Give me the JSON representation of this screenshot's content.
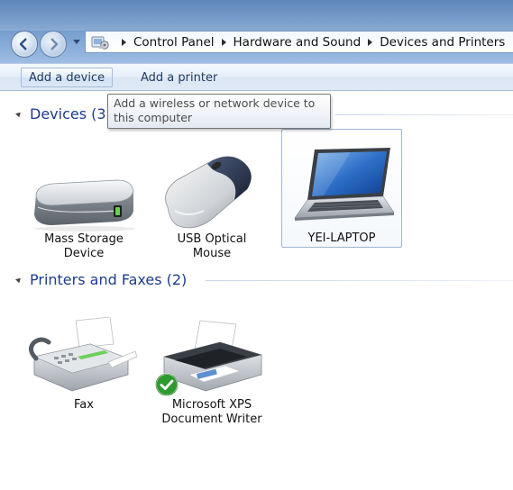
{
  "window": {
    "breadcrumbs": [
      "Control Panel",
      "Hardware and Sound",
      "Devices and Printers"
    ]
  },
  "toolbar": {
    "add_device_label": "Add a device",
    "add_printer_label": "Add a printer"
  },
  "tooltip": {
    "line1": "Add a wireless or network device to",
    "line2": "this computer"
  },
  "groups": {
    "devices": {
      "header": "Devices (3)",
      "items": [
        {
          "label_line1": "Mass Storage",
          "label_line2": "Device",
          "icon": "mass-storage-icon"
        },
        {
          "label_line1": "USB Optical",
          "label_line2": "Mouse",
          "icon": "mouse-icon"
        },
        {
          "label_line1": "YEI-LAPTOP",
          "label_line2": "",
          "icon": "laptop-icon",
          "selected": true
        }
      ]
    },
    "printers": {
      "header": "Printers and Faxes (2)",
      "items": [
        {
          "label_line1": "Fax",
          "label_line2": "",
          "icon": "fax-icon"
        },
        {
          "label_line1": "Microsoft XPS",
          "label_line2": "Document Writer",
          "icon": "printer-icon",
          "default": true
        }
      ]
    }
  },
  "colors": {
    "titlebar": "#6f97c8",
    "group_header": "#1e3c8c",
    "default_check": "#2f9a2f"
  }
}
